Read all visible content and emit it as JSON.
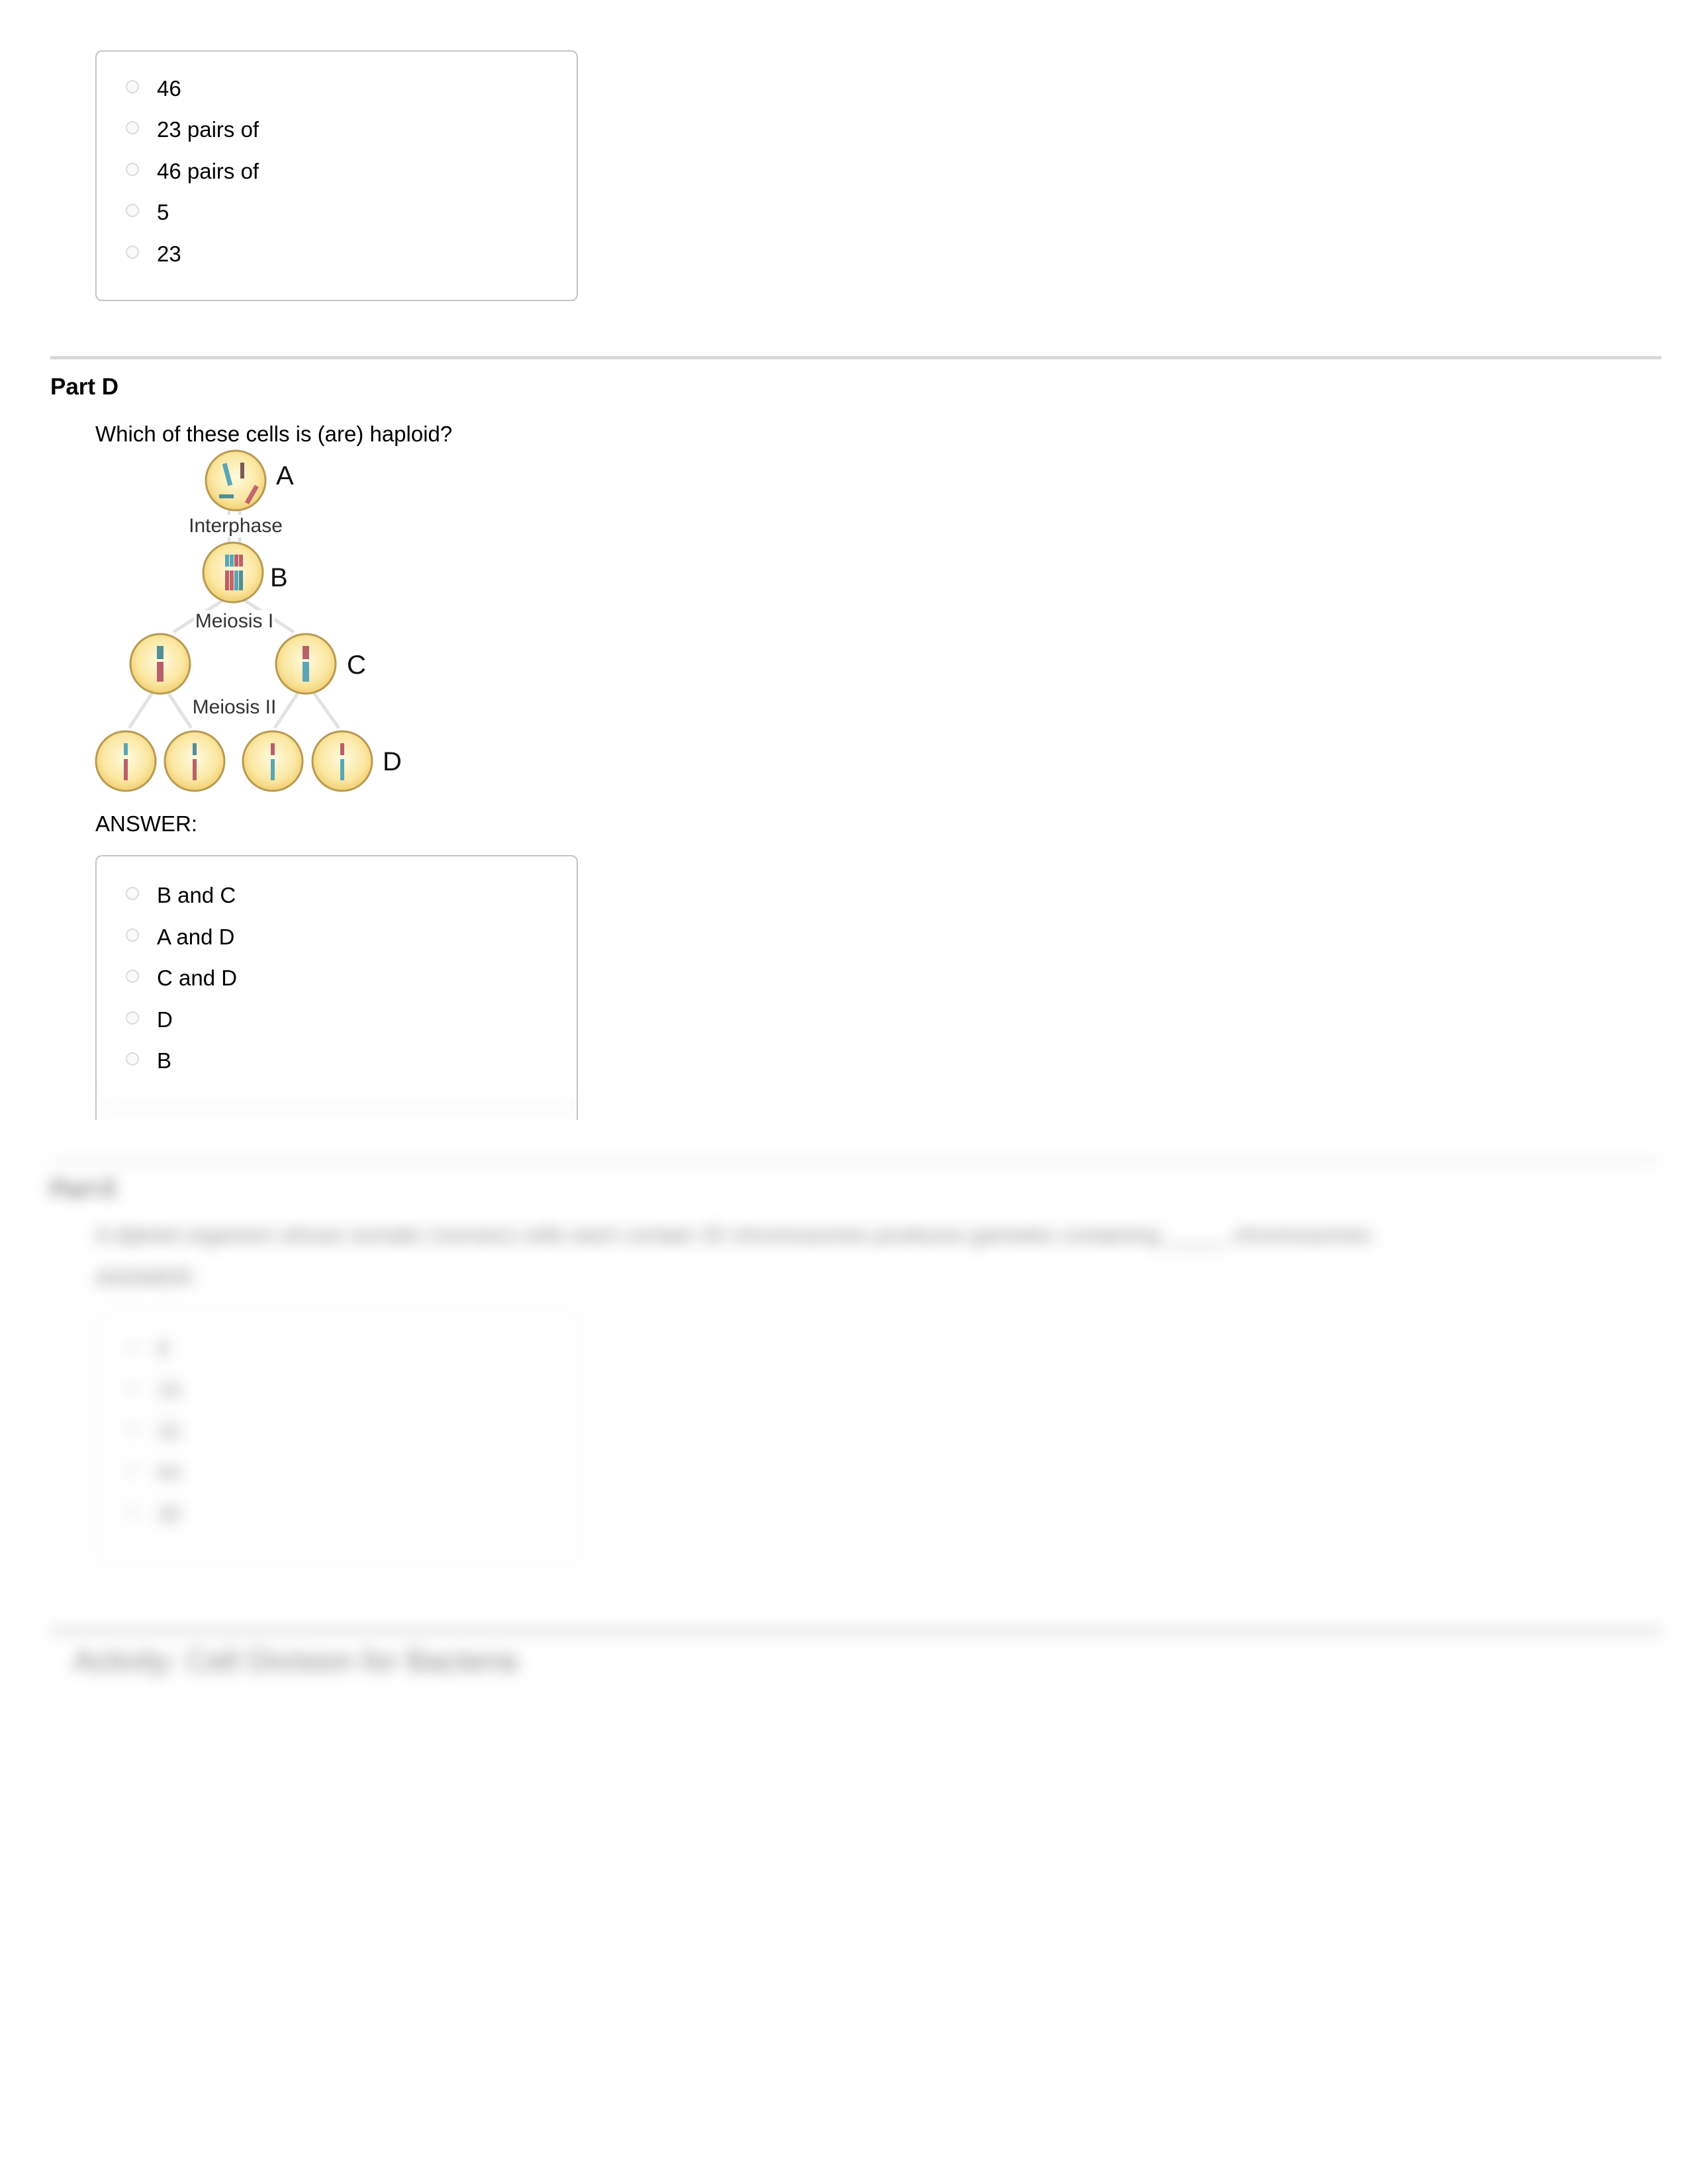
{
  "partC_answer_options": [
    "46",
    "23 pairs of",
    "46 pairs of",
    "5",
    "23"
  ],
  "partD": {
    "title": "Part D",
    "question": "Which of these cells is (are) haploid?",
    "diagram": {
      "cell_labels": [
        "A",
        "B",
        "C",
        "D"
      ],
      "stage_labels": [
        "Interphase",
        "Meiosis I",
        "Meiosis II"
      ],
      "colors": {
        "cell_fill": "#fbe7a1",
        "cell_edge": "#b89a52",
        "chromosome_blue": "#5aa6b6",
        "chromosome_red": "#b9606a",
        "arrow": "#e2e2e2"
      }
    },
    "answer_label": "ANSWER:",
    "answer_options": [
      "B and C",
      "A and D",
      "C and D",
      "D",
      "B"
    ]
  },
  "partE_blurred": {
    "title": "Part E",
    "question": "A diploid organism whose somatic (nonsex) cells each contain 32 chromosomes produces gametes containing _____ chromosomes.",
    "answer_label": "ANSWER:",
    "answer_options": [
      "8",
      "16",
      "32",
      "64",
      "30"
    ]
  },
  "next_activity_blurred": {
    "title": "Activity: Cell Division for Bacteria"
  }
}
